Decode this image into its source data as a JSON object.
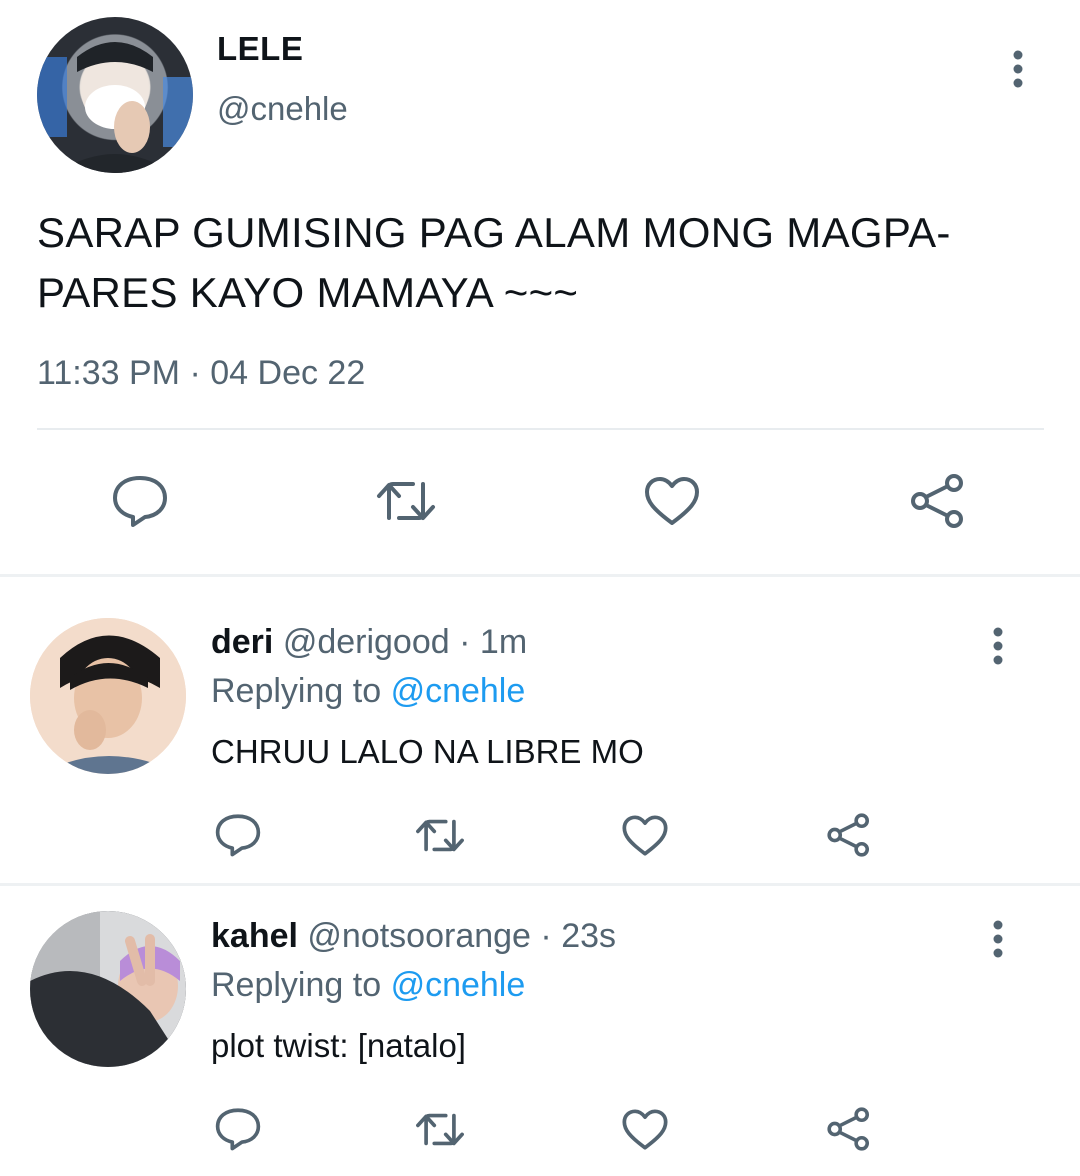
{
  "main_tweet": {
    "name": "LELE",
    "handle": "@cnehle",
    "text": "SARAP GUMISING PAG ALAM MONG MAGPA-PARES KAYO MAMAYA ~~~",
    "time": "11:33 PM",
    "separator": "·",
    "date": "04 Dec 22"
  },
  "replies": [
    {
      "name": "deri",
      "handle": "@derigood",
      "separator": "·",
      "age": "1m",
      "replying_prefix": "Replying to",
      "replying_handle": "@cnehle",
      "text": "CHRUU LALO NA LIBRE MO"
    },
    {
      "name": "kahel",
      "handle": "@notsoorange",
      "separator": "·",
      "age": "23s",
      "replying_prefix": "Replying to",
      "replying_handle": "@cnehle",
      "text": "plot twist: [natalo]"
    }
  ],
  "icons": {
    "more": "more-vertical-icon",
    "reply": "reply-bubble-icon",
    "retweet": "retweet-icon",
    "like": "heart-icon",
    "share": "share-icon"
  },
  "colors": {
    "text": "#0f1419",
    "secondary": "#536471",
    "link": "#1d9bf0",
    "icon": "#536471",
    "divider": "#e8ecef"
  }
}
